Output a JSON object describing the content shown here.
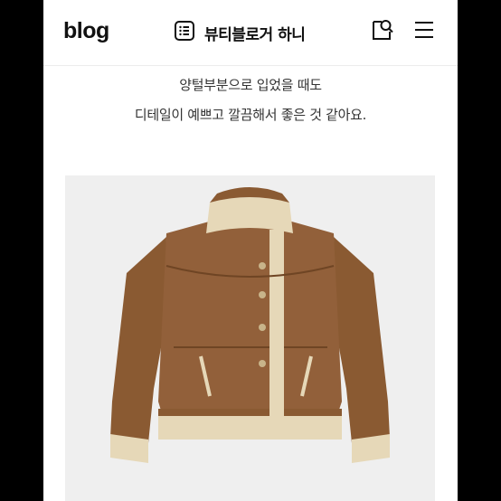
{
  "header": {
    "logo": "blog",
    "blog_name": "뷰티블로거 하니",
    "icons": {
      "list": "list-icon",
      "search": "search-icon",
      "menu": "hamburger-menu-icon"
    }
  },
  "post": {
    "lines": [
      "양털부분으로 입었을 때도",
      "디테일이 예쁘고 깔끔해서 좋은 것 같아요."
    ],
    "image": {
      "subject": "jacket-photo"
    }
  },
  "colors": {
    "background": "#000000",
    "page": "#ffffff",
    "photo_bg": "#efefef",
    "suede": "#8a5a32",
    "shearling": "#e6d8b8"
  }
}
